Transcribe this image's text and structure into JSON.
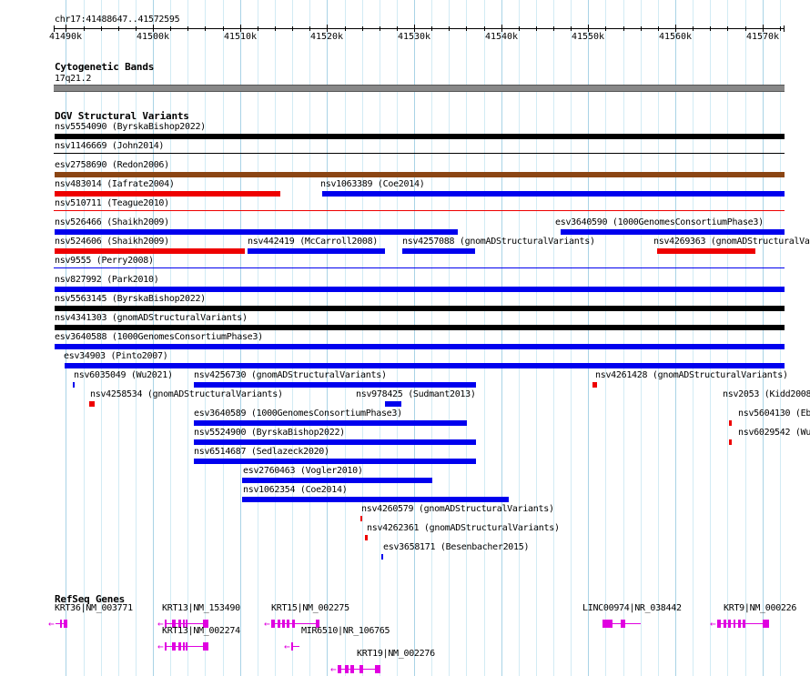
{
  "region": "chr17:41488647..41572595",
  "ruler": {
    "ticks": [
      "41490k",
      "41500k",
      "41510k",
      "41520k",
      "41530k",
      "41540k",
      "41550k",
      "41560k",
      "41570k"
    ]
  },
  "cytoband": {
    "title": "Cytogenetic Bands",
    "band": "17q21.2"
  },
  "dgv": {
    "title": "DGV Structural Variants"
  },
  "refseq": {
    "title": "RefSeq Genes"
  },
  "colors": {
    "gain": "#0000ee",
    "loss": "#ee0000",
    "complex": "#000000",
    "inversion": "#8b4513",
    "gene": "#e000e0",
    "cytoband": "#888888"
  },
  "variants": [
    {
      "label": "nsv5554090 (ByrskaBishop2022)",
      "start": 41488647,
      "end": 41572595,
      "type": "complex"
    },
    {
      "label": "nsv1146669 (John2014)",
      "start": 41488647,
      "end": 41572595,
      "type": "inversion",
      "style": "thin"
    },
    {
      "label": "esv2758690 (Redon2006)",
      "start": 41488647,
      "end": 41572595,
      "type": "inversion"
    },
    {
      "label": "nsv483014 (Iafrate2004)",
      "start": 41488647,
      "end": 41514600,
      "type": "loss"
    },
    {
      "label": "nsv1063389 (Coe2014)",
      "start": 41519400,
      "end": 41572595,
      "type": "gain"
    },
    {
      "label": "nsv510711 (Teague2010)",
      "start": 41488647,
      "end": 41572595,
      "type": "loss",
      "style": "thin"
    },
    {
      "label": "nsv526466 (Shaikh2009)",
      "start": 41488647,
      "end": 41535000,
      "type": "gain"
    },
    {
      "label": "esv3640590 (1000GenomesConsortiumPhase3)",
      "start": 41546800,
      "end": 41572595,
      "type": "gain"
    },
    {
      "label": "nsv524606 (Shaikh2009)",
      "start": 41488647,
      "end": 41510500,
      "type": "loss"
    },
    {
      "label": "nsv442419 (McCarroll2008)",
      "start": 41510900,
      "end": 41526700,
      "type": "gain"
    },
    {
      "label": "nsv4257088 (gnomADStructuralVariants)",
      "start": 41528600,
      "end": 41537000,
      "type": "gain"
    },
    {
      "label": "nsv4269363 (gnomADStructuralVariants)",
      "start": 41557900,
      "end": 41569200,
      "type": "loss"
    },
    {
      "label": "nsv9555 (Perry2008)",
      "start": 41488647,
      "end": 41572595,
      "type": "gain",
      "style": "thin"
    },
    {
      "label": "nsv827992 (Park2010)",
      "start": 41488647,
      "end": 41572595,
      "type": "gain"
    },
    {
      "label": "nsv5563145 (ByrskaBishop2022)",
      "start": 41488647,
      "end": 41572595,
      "type": "complex"
    },
    {
      "label": "nsv4341303 (gnomADStructuralVariants)",
      "start": 41488647,
      "end": 41572595,
      "type": "complex"
    },
    {
      "label": "esv3640588 (1000GenomesConsortiumPhase3)",
      "start": 41488647,
      "end": 41572595,
      "type": "gain"
    },
    {
      "label": "esv34903 (Pinto2007)",
      "start": 41489800,
      "end": 41572595,
      "type": "gain"
    },
    {
      "label": "nsv6035049 (Wu2021)",
      "start": 41490800,
      "end": 41491000,
      "type": "gain"
    },
    {
      "label": "nsv4256730 (gnomADStructuralVariants)",
      "start": 41504700,
      "end": 41537100,
      "type": "gain"
    },
    {
      "label": "nsv4261428 (gnomADStructuralVariants)",
      "start": 41550500,
      "end": 41551000,
      "type": "loss"
    },
    {
      "label": "nsv4258534 (gnomADStructuralVariants)",
      "start": 41492700,
      "end": 41493300,
      "type": "loss"
    },
    {
      "label": "nsv978425 (Sudmant2013)",
      "start": 41526600,
      "end": 41528500,
      "type": "gain"
    },
    {
      "label": "nsv2053 (Kidd2008)",
      "start": 41564500,
      "end": 41572595,
      "type": "gain",
      "style": "thin"
    },
    {
      "label": "esv3640589 (1000GenomesConsortiumPhase3)",
      "start": 41504700,
      "end": 41536100,
      "type": "gain"
    },
    {
      "label": "nsv5604130 (Ebert2021)",
      "start": 41566200,
      "end": 41566500,
      "type": "loss"
    },
    {
      "label": "nsv5524900 (ByrskaBishop2022)",
      "start": 41504700,
      "end": 41537100,
      "type": "gain"
    },
    {
      "label": "nsv6029542 (Wu2021)",
      "start": 41566200,
      "end": 41566500,
      "type": "loss"
    },
    {
      "label": "nsv6514687 (Sedlazeck2020)",
      "start": 41504700,
      "end": 41537100,
      "type": "gain"
    },
    {
      "label": "esv2760463 (Vogler2010)",
      "start": 41510200,
      "end": 41532100,
      "type": "gain"
    },
    {
      "label": "nsv1062354 (Coe2014)",
      "start": 41510200,
      "end": 41540900,
      "type": "gain"
    },
    {
      "label": "nsv4260579 (gnomADStructuralVariants)",
      "start": 41523800,
      "end": 41524000,
      "type": "loss"
    },
    {
      "label": "nsv4262361 (gnomADStructuralVariants)",
      "start": 41524400,
      "end": 41524700,
      "type": "loss"
    },
    {
      "label": "esv3658171 (Besenbacher2015)",
      "start": 41526200,
      "end": 41526400,
      "type": "gain"
    }
  ],
  "genes": [
    {
      "label": "KRT36|NM_003771",
      "start": 41488800,
      "end": 41490200,
      "exons": [
        [
          41489300,
          41489400
        ],
        [
          41489700,
          41490200
        ]
      ],
      "strand": "-"
    },
    {
      "label": "KRT13|NM_153490",
      "start": 41501300,
      "end": 41506400,
      "exons": [
        [
          41501300,
          41501600
        ],
        [
          41502200,
          41502600
        ],
        [
          41502900,
          41503200
        ],
        [
          41503400,
          41503600
        ],
        [
          41503800,
          41504000
        ],
        [
          41505700,
          41506400
        ]
      ],
      "strand": "-"
    },
    {
      "label": "KRT15|NM_002275",
      "start": 41513600,
      "end": 41519100,
      "exons": [
        [
          41513600,
          41514000
        ],
        [
          41514300,
          41514600
        ],
        [
          41514800,
          41515100
        ],
        [
          41515400,
          41515700
        ],
        [
          41516000,
          41516300
        ],
        [
          41518700,
          41519100
        ]
      ],
      "strand": "-"
    },
    {
      "label": "LINC00974|NR_038442",
      "start": 41551600,
      "end": 41556000,
      "exons": [
        [
          41551600,
          41552800
        ],
        [
          41553700,
          41554200
        ]
      ],
      "strand": "+"
    },
    {
      "label": "KRT9|NM_000226",
      "start": 41564800,
      "end": 41570800,
      "exons": [
        [
          41564800,
          41565200
        ],
        [
          41565500,
          41565800
        ],
        [
          41566100,
          41566400
        ],
        [
          41566700,
          41566900
        ],
        [
          41567200,
          41567500
        ],
        [
          41567700,
          41568000
        ],
        [
          41570000,
          41570800
        ]
      ],
      "strand": "-"
    },
    {
      "label": "KRT13|NM_002274",
      "start": 41501300,
      "end": 41506400,
      "exons": [
        [
          41501300,
          41501600
        ],
        [
          41502200,
          41502600
        ],
        [
          41502900,
          41503200
        ],
        [
          41503400,
          41503600
        ],
        [
          41503800,
          41504000
        ],
        [
          41505700,
          41506400
        ]
      ],
      "strand": "-"
    },
    {
      "label": "MIR6510|NR_106765",
      "start": 41515900,
      "end": 41516800,
      "exons": [
        [
          41515900,
          41516100
        ]
      ],
      "strand": "-"
    },
    {
      "label": "KRT19|NM_002276",
      "start": 41521200,
      "end": 41526100,
      "exons": [
        [
          41521200,
          41521600
        ],
        [
          41522000,
          41522500
        ],
        [
          41522700,
          41523100
        ],
        [
          41523700,
          41524100
        ],
        [
          41525500,
          41526100
        ]
      ],
      "strand": "-"
    }
  ]
}
